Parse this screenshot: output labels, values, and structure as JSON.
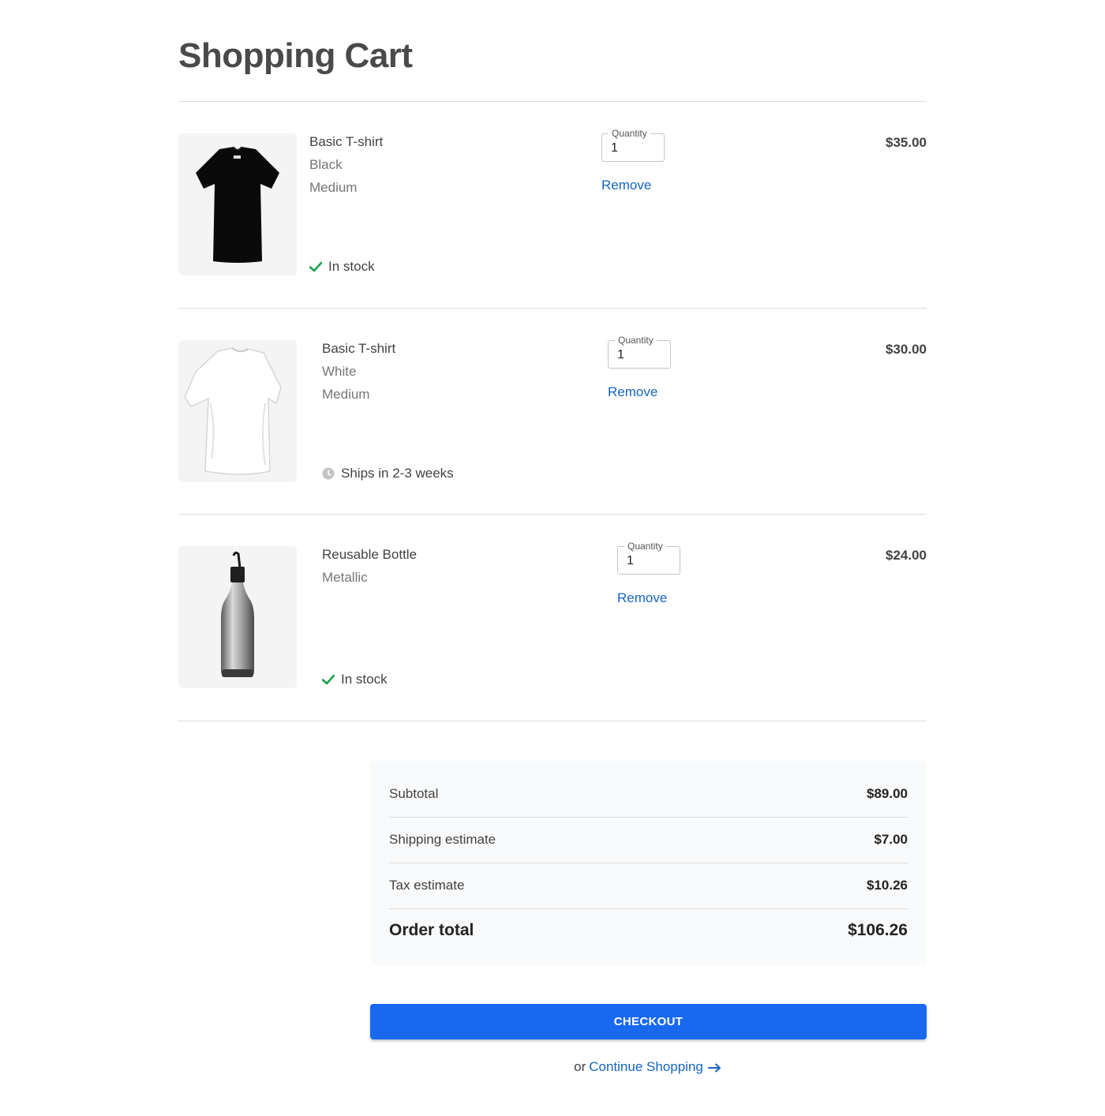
{
  "page": {
    "title": "Shopping Cart"
  },
  "items": [
    {
      "name": "Basic T-shirt",
      "attrs": [
        "Black",
        "Medium"
      ],
      "status": "In stock",
      "status_type": "in-stock",
      "quantity_label": "Quantity",
      "quantity": "1",
      "remove_label": "Remove",
      "price": "$35.00"
    },
    {
      "name": "Basic T-shirt",
      "attrs": [
        "White",
        "Medium"
      ],
      "status": "Ships in 2-3 weeks",
      "status_type": "ships-later",
      "quantity_label": "Quantity",
      "quantity": "1",
      "remove_label": "Remove",
      "price": "$30.00"
    },
    {
      "name": "Reusable Bottle",
      "attrs": [
        "Metallic"
      ],
      "status": "In stock",
      "status_type": "in-stock",
      "quantity_label": "Quantity",
      "quantity": "1",
      "remove_label": "Remove",
      "price": "$24.00"
    }
  ],
  "summary": {
    "subtotal_label": "Subtotal",
    "subtotal": "$89.00",
    "shipping_label": "Shipping estimate",
    "shipping": "$7.00",
    "tax_label": "Tax estimate",
    "tax": "$10.26",
    "total_label": "Order total",
    "total": "$106.26"
  },
  "checkout": {
    "label": "CHECKOUT"
  },
  "continue": {
    "prefix": "or",
    "link": "Continue Shopping"
  },
  "colors": {
    "accent": "#1869f0",
    "link": "#1565c0",
    "in_stock": "#1aa34a",
    "pending": "#c4c4c4"
  },
  "icons": {
    "in_stock": "check-icon",
    "ships_later": "clock-icon",
    "continue": "arrow-right-icon"
  }
}
